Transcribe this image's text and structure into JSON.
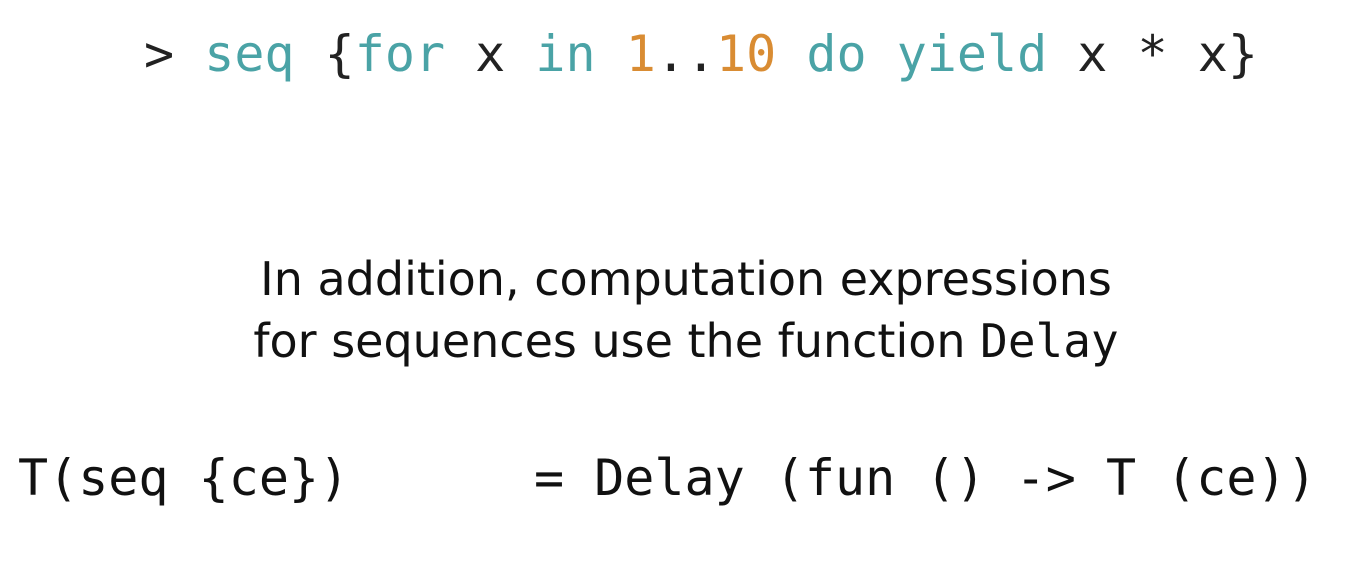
{
  "code_example": {
    "tokens": [
      {
        "text": "> ",
        "kind": "plain"
      },
      {
        "text": "seq",
        "kind": "keyword"
      },
      {
        "text": " {",
        "kind": "plain"
      },
      {
        "text": "for",
        "kind": "keyword"
      },
      {
        "text": " x ",
        "kind": "plain"
      },
      {
        "text": "in",
        "kind": "keyword"
      },
      {
        "text": " ",
        "kind": "plain"
      },
      {
        "text": "1",
        "kind": "number"
      },
      {
        "text": "..",
        "kind": "plain"
      },
      {
        "text": "10",
        "kind": "number"
      },
      {
        "text": " ",
        "kind": "plain"
      },
      {
        "text": "do",
        "kind": "keyword"
      },
      {
        "text": " ",
        "kind": "plain"
      },
      {
        "text": "yield",
        "kind": "keyword"
      },
      {
        "text": " x * x}",
        "kind": "plain"
      }
    ],
    "colors": {
      "keyword": "#4aa3a6",
      "number": "#d98c33",
      "plain": "#222222"
    }
  },
  "description": {
    "line1": "In addition, computation expressions",
    "line2_prefix": "for sequences use the function ",
    "line2_code": "Delay"
  },
  "translation_rule": {
    "lhs": "T(seq {ce})",
    "rhs": "= Delay (fun () -> T (ce))"
  }
}
